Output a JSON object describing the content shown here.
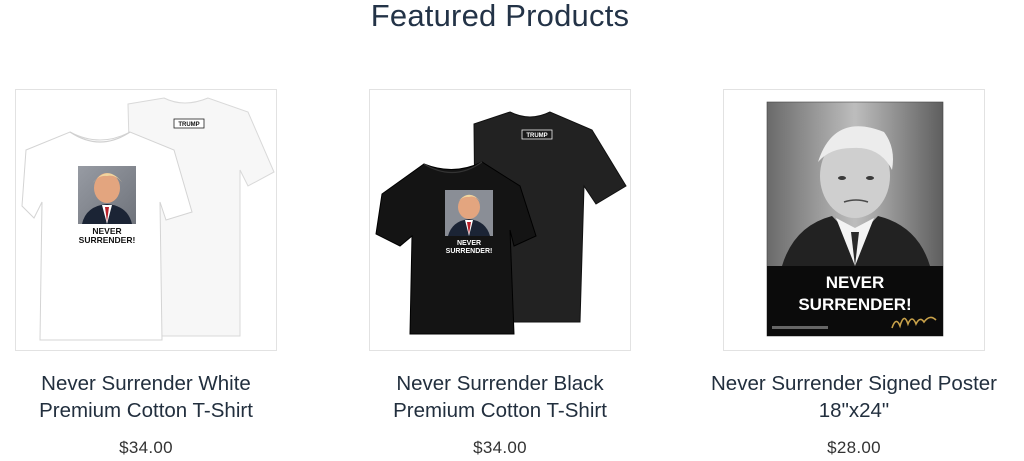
{
  "section": {
    "title": "Featured Products"
  },
  "products": [
    {
      "title_line1": "Never Surrender White",
      "title_line2": "Premium Cotton T-Shirt",
      "price": "$34.00",
      "image": {
        "shirt_color": "#ffffff",
        "print_text_1": "NEVER",
        "print_text_2": "SURRENDER!",
        "tag_text": "TRUMP"
      }
    },
    {
      "title_line1": "Never Surrender Black",
      "title_line2": "Premium Cotton T-Shirt",
      "price": "$34.00",
      "image": {
        "shirt_color": "#1a1a1a",
        "print_text_1": "NEVER",
        "print_text_2": "SURRENDER!",
        "tag_text": "TRUMP"
      }
    },
    {
      "title_line1": "Never Surrender Signed Poster",
      "title_line2": "18\"x24\"",
      "price": "$28.00",
      "image": {
        "print_text_1": "NEVER",
        "print_text_2": "SURRENDER!"
      }
    }
  ],
  "colors": {
    "title": "#233347",
    "product_title": "#222f3e",
    "price": "#333333",
    "border": "#e2e2e2"
  }
}
